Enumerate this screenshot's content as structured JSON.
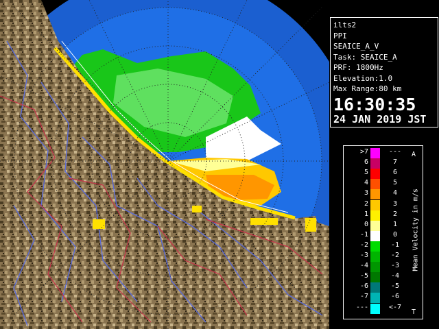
{
  "info": {
    "site": "ilts2",
    "mode": "PPI",
    "product": "SEAICE_A_V",
    "task": "Task: SEAICE_A",
    "prf": "PRF: 1800Hz",
    "elevation": "Elevation:1.0",
    "max_range": "Max Range:80 km",
    "time": "16:30:35",
    "date": "24 JAN 2019 JST"
  },
  "legend": {
    "title": "Mean Velocity in m/s",
    "corner_top": "A",
    "corner_bottom": "T",
    "rows": [
      {
        "left": ">7",
        "right": "---",
        "color": "#ff00ff"
      },
      {
        "left": "6",
        "right": "7",
        "color": "#c80064"
      },
      {
        "left": "5",
        "right": "6",
        "color": "#ff0000"
      },
      {
        "left": "4",
        "right": "5",
        "color": "#ff5000"
      },
      {
        "left": "3",
        "right": "4",
        "color": "#ff9600"
      },
      {
        "left": "2",
        "right": "3",
        "color": "#ffc800"
      },
      {
        "left": "1",
        "right": "2",
        "color": "#fff000"
      },
      {
        "left": "0",
        "right": "1",
        "color": "#ffff96"
      },
      {
        "left": "-1",
        "right": "0",
        "color": "#ffffff"
      },
      {
        "left": "-2",
        "right": "-1",
        "color": "#00dc00"
      },
      {
        "left": "-3",
        "right": "-2",
        "color": "#00b400"
      },
      {
        "left": "-4",
        "right": "-3",
        "color": "#009600"
      },
      {
        "left": "-5",
        "right": "-4",
        "color": "#007800"
      },
      {
        "left": "-6",
        "right": "-5",
        "color": "#007878"
      },
      {
        "left": "-7",
        "right": "-6",
        "color": "#00b4b4"
      },
      {
        "left": "---",
        "right": "<-7",
        "color": "#00ffff"
      }
    ]
  }
}
